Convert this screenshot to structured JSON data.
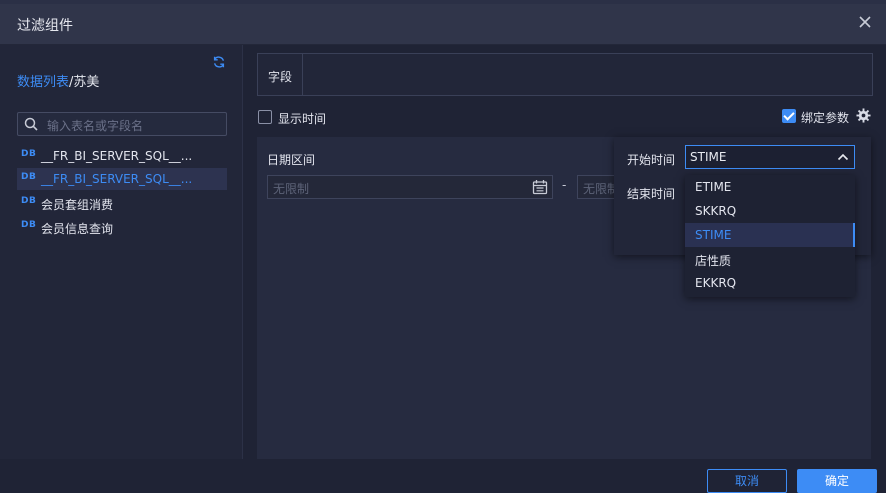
{
  "dialog": {
    "title": "过滤组件"
  },
  "left": {
    "breadcrumb": {
      "root": "数据列表",
      "separator": "/",
      "current": "苏美"
    },
    "search": {
      "placeholder": "输入表名或字段名"
    },
    "tables": [
      {
        "badge": "DB",
        "label": "__FR_BI_SERVER_SQL__...",
        "selected": false
      },
      {
        "badge": "DB",
        "label": "__FR_BI_SERVER_SQL__...",
        "selected": true
      },
      {
        "badge": "DB",
        "label": "会员套组消费",
        "selected": false
      },
      {
        "badge": "DB",
        "label": "会员信息查询",
        "selected": false
      }
    ]
  },
  "main": {
    "field_label": "字段",
    "show_time": {
      "label": "显示时间",
      "checked": false
    },
    "bind_params": {
      "label": "绑定参数",
      "checked": true
    },
    "date_range": {
      "label": "日期区间",
      "start_placeholder": "无限制",
      "separator": "-",
      "end_placeholder": "无限制"
    },
    "param_popup": {
      "start_label": "开始时间",
      "end_label": "结束时间",
      "start_value": "STIME",
      "options": [
        "ETIME",
        "SKKRQ",
        "STIME",
        "店性质",
        "EKKRQ"
      ],
      "selected_index": 2
    }
  },
  "footer": {
    "cancel_label": "取消",
    "ok_label": "确定"
  },
  "colors": {
    "accent": "#3d8cf5",
    "background": "#1f2335",
    "header": "#30354a"
  }
}
